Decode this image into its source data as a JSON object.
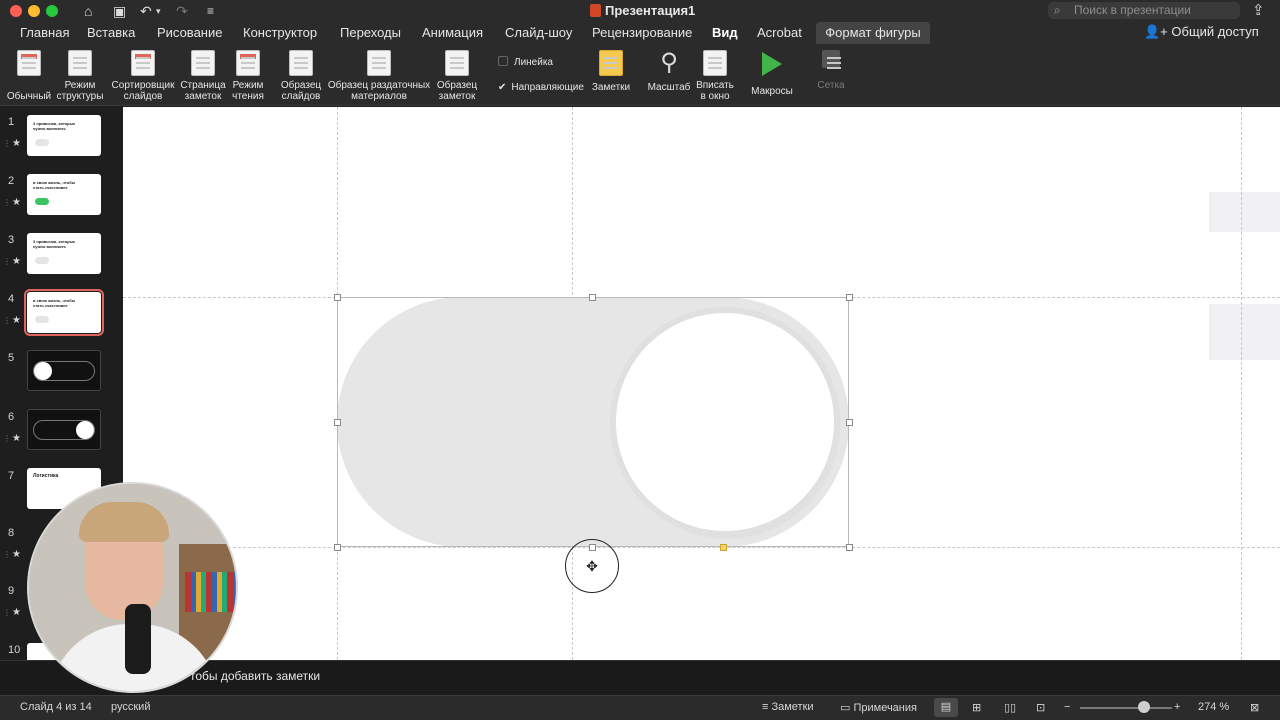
{
  "title_bar": {
    "document_title": "Презентация1",
    "search_placeholder": "Поиск в презентации"
  },
  "tabs": [
    {
      "label": "Главная"
    },
    {
      "label": "Вставка"
    },
    {
      "label": "Рисование"
    },
    {
      "label": "Конструктор"
    },
    {
      "label": "Переходы"
    },
    {
      "label": "Анимация"
    },
    {
      "label": "Слайд-шоу"
    },
    {
      "label": "Рецензирование"
    },
    {
      "label": "Вид"
    },
    {
      "label": "Acrobat"
    },
    {
      "label": "Формат фигуры"
    }
  ],
  "share_label": "Общий доступ",
  "ribbon": {
    "normal": "Обычный",
    "outline": [
      "Режим",
      "структуры"
    ],
    "sorter": [
      "Сортировщик",
      "слайдов"
    ],
    "notes_page": [
      "Страница",
      "заметок"
    ],
    "reading": [
      "Режим",
      "чтения"
    ],
    "slide_master": [
      "Образец",
      "слайдов"
    ],
    "handout_master": [
      "Образец раздаточных",
      "материалов"
    ],
    "notes_master": [
      "Образец",
      "заметок"
    ],
    "ruler": "Линейка",
    "guides": "Направляющие",
    "notes": "Заметки",
    "zoom": "Масштаб",
    "fit": [
      "Вписать",
      "в окно"
    ],
    "macros": "Макросы",
    "grid": "Сетка"
  },
  "slides": [
    {
      "num": "1",
      "text": "3 привычки, которые нужно включить"
    },
    {
      "num": "2",
      "text": "в свою жизнь, чтобы стать счастливее"
    },
    {
      "num": "3",
      "text": "3 привычки, которые нужно включить"
    },
    {
      "num": "4",
      "text": "в свою жизнь, чтобы стать счастливее"
    },
    {
      "num": "5"
    },
    {
      "num": "6"
    },
    {
      "num": "7",
      "text": "Логистика"
    },
    {
      "num": "8"
    },
    {
      "num": "9"
    },
    {
      "num": "10"
    }
  ],
  "notes_placeholder": "тобы добавить заметки",
  "status": {
    "slide_counter": "Слайд 4 из 14",
    "language": "русский",
    "notes": "Заметки",
    "comments": "Примечания",
    "zoom": "274 %"
  },
  "zoom_level": 0.63,
  "colors": {
    "accent_red": "#e0665c",
    "switch_on": "#3cc463",
    "macros_green": "#41b549"
  }
}
